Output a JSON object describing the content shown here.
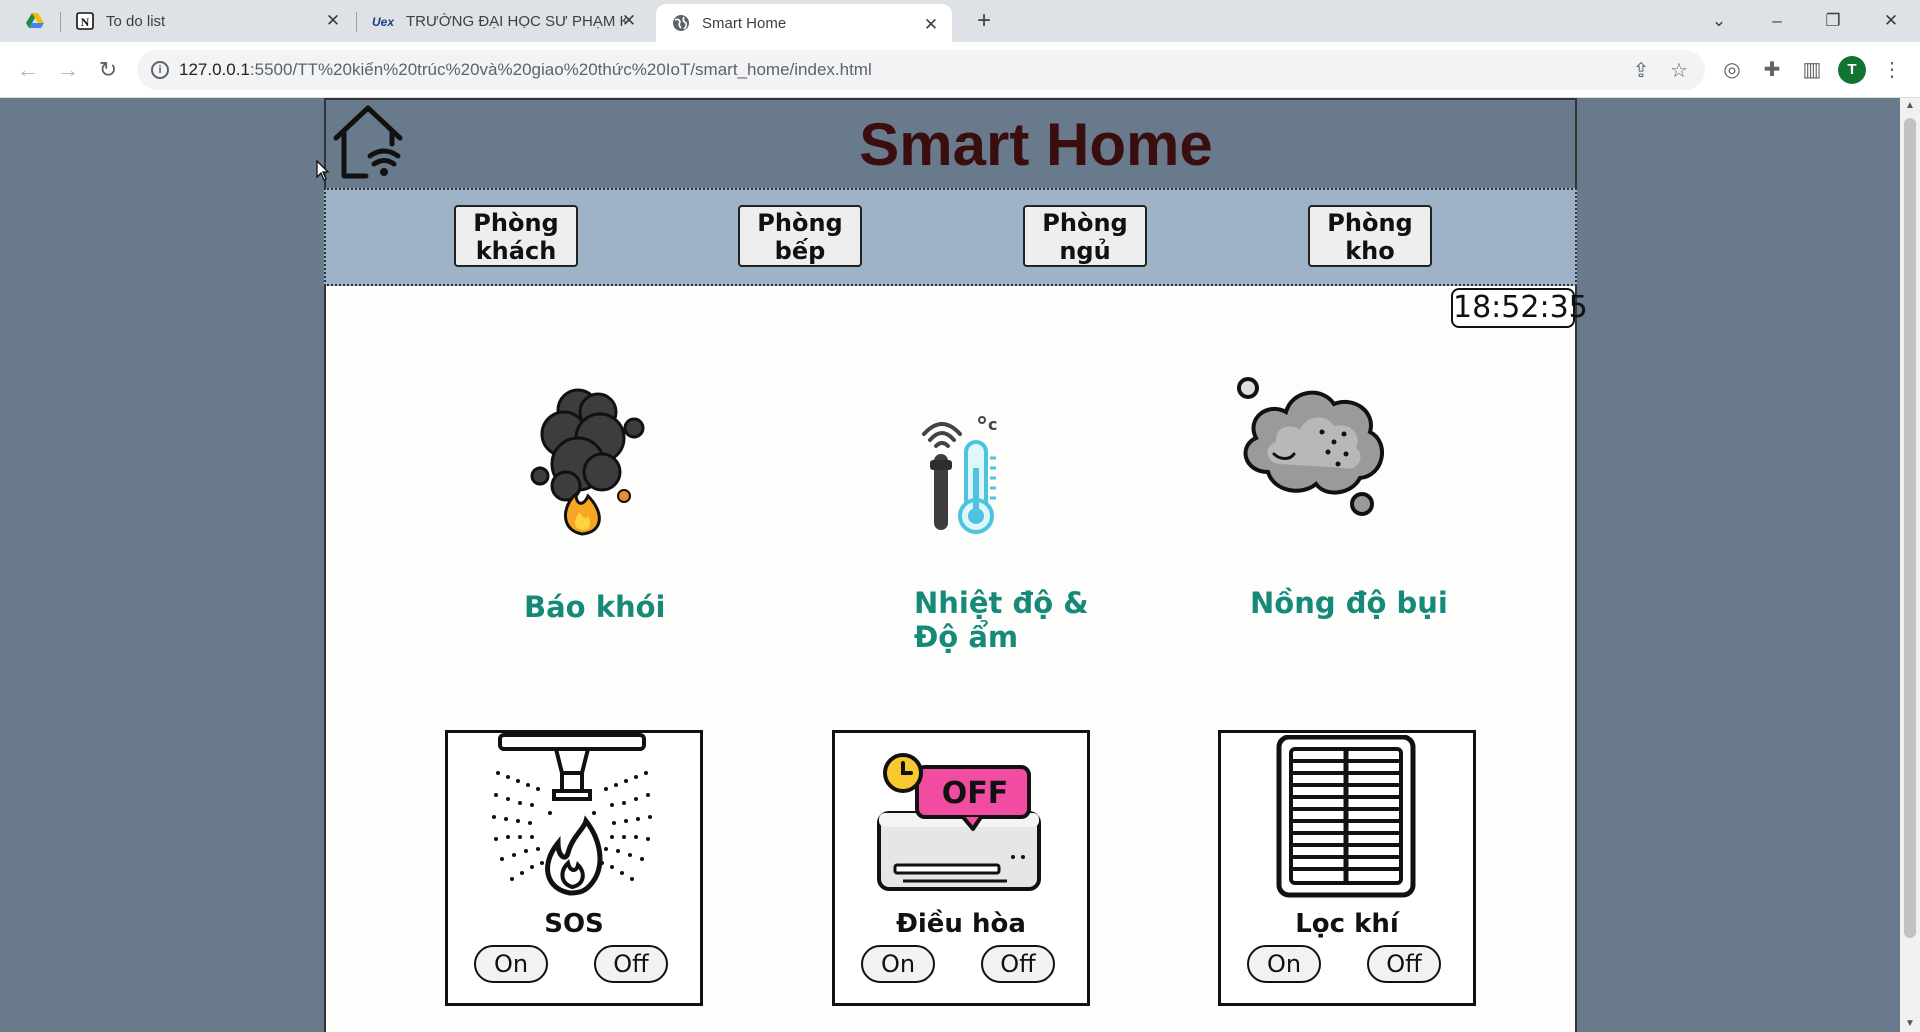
{
  "browser": {
    "tabs": [
      {
        "title": "To do list",
        "icon": "notion-icon"
      },
      {
        "title": "TRƯỜNG ĐẠI HỌC SƯ PHẠM KỸ",
        "icon": "ute-icon"
      },
      {
        "title": "Smart Home",
        "icon": "globe-icon"
      }
    ],
    "active_tab": 2,
    "url_host": "127.0.0.1",
    "url_path": ":5500/TT%20kiến%20trúc%20và%20giao%20thức%20IoT/smart_home/index.html",
    "profile_initial": "T"
  },
  "header": {
    "title": "Smart Home",
    "logo_icon": "smart-home-wifi-icon"
  },
  "nav": {
    "rooms": [
      {
        "line1": "Phòng",
        "line2": "khách"
      },
      {
        "line1": "Phòng",
        "line2": "bếp"
      },
      {
        "line1": "Phòng",
        "line2": "ngủ"
      },
      {
        "line1": "Phòng",
        "line2": "kho"
      }
    ]
  },
  "clock": "18:52:35",
  "sensors": [
    {
      "label": "Báo khói",
      "icon": "smoke-fire-icon"
    },
    {
      "label_line1": "Nhiệt độ &",
      "label_line2": "Độ ẩm",
      "icon": "thermometer-icon"
    },
    {
      "label": "Nồng độ bụi",
      "icon": "dust-cloud-icon"
    }
  ],
  "devices": [
    {
      "label": "SOS",
      "icon": "sprinkler-icon",
      "on_label": "On",
      "off_label": "Off"
    },
    {
      "label": "Điều hòa",
      "icon": "air-conditioner-off-icon",
      "on_label": "On",
      "off_label": "Off",
      "badge": "OFF"
    },
    {
      "label": "Lọc khí",
      "icon": "air-purifier-icon",
      "on_label": "On",
      "off_label": "Off"
    }
  ],
  "colors": {
    "background": "#687a8b",
    "nav_bar": "#9fb3c8",
    "title": "#3a0e0e",
    "sensor_label": "#168a78"
  }
}
